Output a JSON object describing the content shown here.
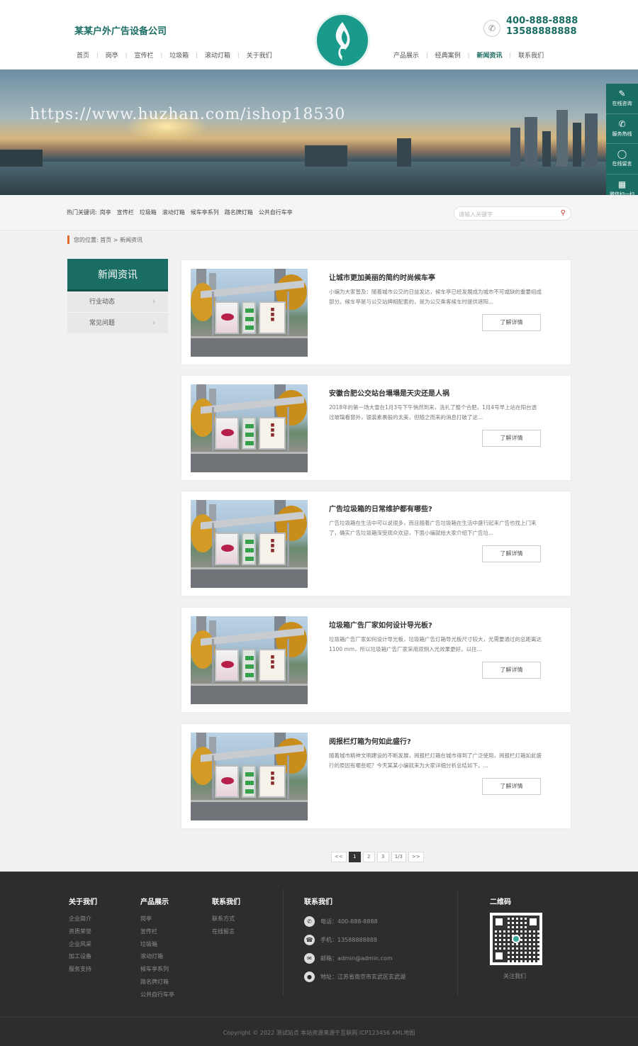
{
  "header": {
    "company_name": "某某户外广告设备公司",
    "phone1": "400-888-8888",
    "phone2": "13588888888",
    "nav_left": [
      "首页",
      "岗亭",
      "宣传栏",
      "垃圾箱",
      "滚动灯箱",
      "关于我们"
    ],
    "nav_right": [
      "产品展示",
      "经典案例",
      "新闻资讯",
      "联系我们"
    ],
    "active_nav": "新闻资讯"
  },
  "banner": {
    "watermark": "https://www.huzhan.com/ishop18530"
  },
  "float_bar": [
    {
      "icon": "chat-icon",
      "label": "在线咨询"
    },
    {
      "icon": "phone-icon",
      "label": "服务热线"
    },
    {
      "icon": "message-icon",
      "label": "在线留言"
    },
    {
      "icon": "qrcode-icon",
      "label": "微信扫一扫"
    }
  ],
  "hotbar": {
    "label": "热门关键词:",
    "keywords": [
      "岗亭",
      "宣传栏",
      "垃圾箱",
      "滚动灯箱",
      "候车亭系列",
      "路名牌灯箱",
      "公共自行车亭"
    ],
    "search_placeholder": "请输入关键字"
  },
  "breadcrumb": {
    "text": "您的位置: 首页 > 新闻资讯"
  },
  "sidebar": {
    "title": "新闻资讯",
    "items": [
      "行业动态",
      "常见问题"
    ]
  },
  "news": [
    {
      "title": "让城市更加美丽的简约时尚候车亭",
      "desc": "小编为大家普及：随着城市公交的日益发达，候车亭已经发展成为城市不可或缺的重要组成部分。候车亭是与公交站牌相配套的，是为公交乘客候车时提供遮阳...",
      "more": "了解详情"
    },
    {
      "title": "安徽合肥公交站台塌塌是天灾还是人祸",
      "desc": "2018年的第一场大雪在1月3号下午悄然到来，洗礼了整个合肥，1月4号早上站在阳台透过玻璃看窗外，银装素裹般的太美，但随之而来的消息打破了这...",
      "more": "了解详情"
    },
    {
      "title": "广告垃圾箱的日常维护都有哪些?",
      "desc": "广告垃圾箱在生活中可以说很多，而且随着广告垃圾箱在生活中盛行起来广告也找上门来了，确实广告垃圾箱深受观众欢迎，下面小编就给大家介绍下广告垃...",
      "more": "了解详情"
    },
    {
      "title": "垃圾箱广告厂家如何设计导光板?",
      "desc": "垃圾箱广告厂家如何设计导光板，垃圾箱广告灯箱导光板尺寸较大，光需要通过的总距离达1100 mm，所以垃圾箱广告厂家采用双侧入光效果更好。以往...",
      "more": "了解详情"
    },
    {
      "title": "阅报栏灯箱为何如此盛行?",
      "desc": "随着城市精神文明建设的不断发展，阅报栏灯箱在城市得到了广泛使用，阅报栏灯箱如此盛行的原因有哪些呢？今天某某小编就来为大家详细分析总结如下。...",
      "more": "了解详情"
    }
  ],
  "pagination": [
    "<<",
    "1",
    "2",
    "3",
    "1/3",
    ">>"
  ],
  "footer": {
    "col1": {
      "title": "关于我们",
      "links": [
        "企业简介",
        "资质荣誉",
        "企业风采",
        "加工设备",
        "服务支持"
      ]
    },
    "col2": {
      "title": "产品展示",
      "links": [
        "岗亭",
        "宣传栏",
        "垃圾箱",
        "滚动灯箱",
        "候车亭系列",
        "路名牌灯箱",
        "公共自行车亭"
      ]
    },
    "col3": {
      "title": "联系我们",
      "links": [
        "联系方式",
        "在线留言"
      ]
    },
    "contact": {
      "title": "联系我们",
      "rows": [
        {
          "icon": "phone-icon",
          "text": "电话：400-888-8888"
        },
        {
          "icon": "telephone-icon",
          "text": "手机：13588888888"
        },
        {
          "icon": "mail-icon",
          "text": "邮箱：admin@admin.com"
        },
        {
          "icon": "location-icon",
          "text": "地址：江苏省南京市玄武区玄武湖"
        }
      ]
    },
    "qr": {
      "title": "二维码",
      "caption": "关注我们"
    },
    "copyright": "Copyright © 2022 测试站点 本站资源来源于互联网  ICP123456  XML地图"
  },
  "colors": {
    "brand": "#1a6d62",
    "accent": "#e26a2c",
    "footer_bg": "#2d2d2d"
  }
}
